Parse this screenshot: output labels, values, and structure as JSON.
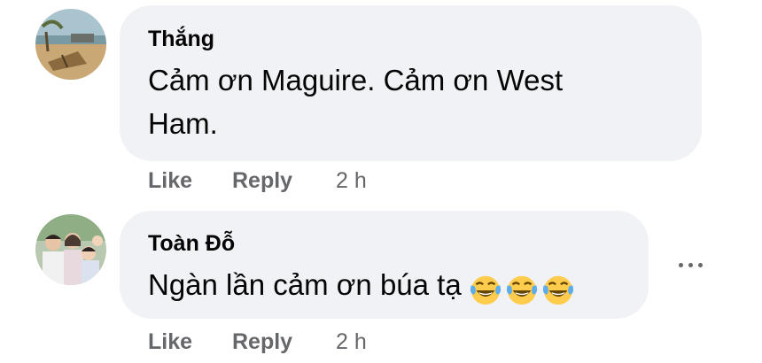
{
  "comments": [
    {
      "author": "Thắng",
      "text_line1": "Cảm ơn Maguire. Cảm ơn West",
      "text_line2": "Ham.",
      "like_label": "Like",
      "reply_label": "Reply",
      "time": "2 h",
      "avatar_icon": "beach-landscape-avatar"
    },
    {
      "author": "Toàn Đỗ",
      "text": "Ngàn lần cảm ơn búa tạ",
      "emojis": [
        "tears-of-joy-emoji",
        "tears-of-joy-emoji",
        "tears-of-joy-emoji"
      ],
      "like_label": "Like",
      "reply_label": "Reply",
      "time": "2 h",
      "avatar_icon": "family-photo-avatar"
    }
  ],
  "more_options_icon": "more-horizontal-icon",
  "colors": {
    "bubble_bg": "#f0f2f5",
    "text": "#050505",
    "secondary_text": "#65676b",
    "emoji_yellow": "#ffcc4d",
    "emoji_tear": "#5dadec"
  }
}
